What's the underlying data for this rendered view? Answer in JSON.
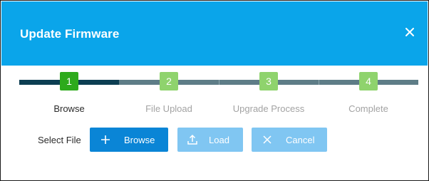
{
  "dialog": {
    "title": "Update Firmware"
  },
  "steps": [
    {
      "number": "1",
      "label": "Browse",
      "state": "active"
    },
    {
      "number": "2",
      "label": "File Upload",
      "state": "inactive"
    },
    {
      "number": "3",
      "label": "Upgrade Process",
      "state": "inactive"
    },
    {
      "number": "4",
      "label": "Complete",
      "state": "inactive"
    }
  ],
  "file_row": {
    "label": "Select File",
    "buttons": {
      "browse": {
        "label": "Browse",
        "icon": "plus-icon",
        "enabled": true
      },
      "load": {
        "label": "Load",
        "icon": "upload-icon",
        "enabled": false
      },
      "cancel": {
        "label": "Cancel",
        "icon": "close-icon",
        "enabled": false
      }
    }
  },
  "colors": {
    "header": "#0aa5ea",
    "step_active": "#2eaa1c",
    "step_inactive": "#8fd36d",
    "track_done": "#0c3e52",
    "track_todo": "#5e7d87",
    "button_primary": "#0a85d6",
    "button_disabled": "#80c6f2"
  }
}
